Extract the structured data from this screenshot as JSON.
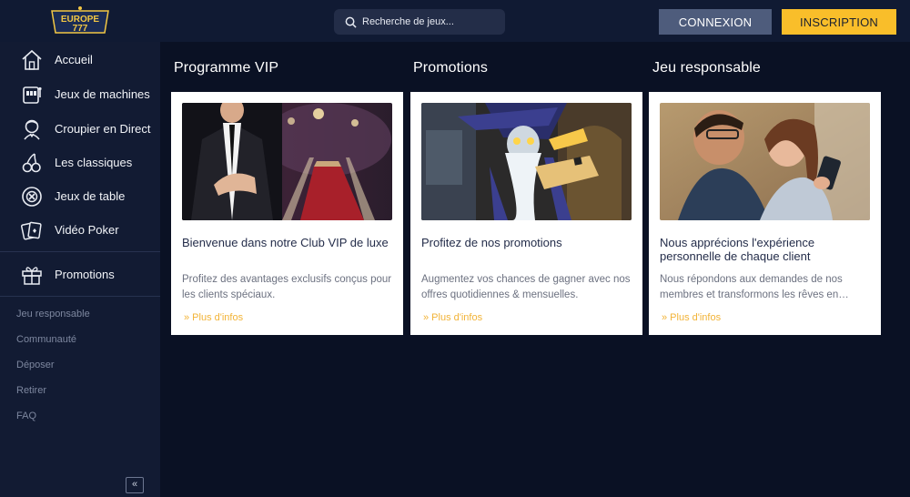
{
  "brand": {
    "logo_text": "EUROPE",
    "logo_number": "777"
  },
  "search": {
    "placeholder": "Recherche de jeux..."
  },
  "header": {
    "login_label": "CONNEXION",
    "register_label": "INSCRIPTION"
  },
  "sidebar": {
    "items": [
      {
        "label": "Accueil",
        "icon": "house-icon"
      },
      {
        "label": "Jeux de machines",
        "icon": "slot-machine-icon"
      },
      {
        "label": "Croupier en Direct",
        "icon": "dealer-icon"
      },
      {
        "label": "Les classiques",
        "icon": "cherries-icon"
      },
      {
        "label": "Jeux de table",
        "icon": "roulette-chip-icon"
      },
      {
        "label": "Vidéo Poker",
        "icon": "cards-icon"
      }
    ],
    "promo": {
      "label": "Promotions",
      "icon": "gift-icon"
    },
    "secondary": [
      "Jeu responsable",
      "Communauté",
      "Déposer",
      "Retirer",
      "FAQ"
    ],
    "collapse_label": "«"
  },
  "main": {
    "columns": [
      {
        "heading": "Programme VIP",
        "card_title": "Bienvenue dans notre Club VIP de luxe",
        "card_desc": "Profitez des avantages exclusifs conçus pour les clients spéciaux.",
        "more": "»  Plus d'infos"
      },
      {
        "heading": "Promotions",
        "card_title": "Profitez de nos promotions",
        "card_desc": "Augmentez vos chances de gagner avec nos offres quotidiennes & mensuelles.",
        "more": "»  Plus d'infos"
      },
      {
        "heading": "Jeu responsable",
        "card_title": "Nous apprécions l'expérience personnelle de chaque client",
        "card_desc": "Nous répondons aux demandes de nos membres et transformons les rêves en…",
        "more": "»  Plus d'infos"
      }
    ]
  },
  "colors": {
    "accent": "#f9be2a",
    "login_bg": "#4e5c7c",
    "sidebar_bg": "#121b33",
    "main_bg": "#0a1124"
  }
}
